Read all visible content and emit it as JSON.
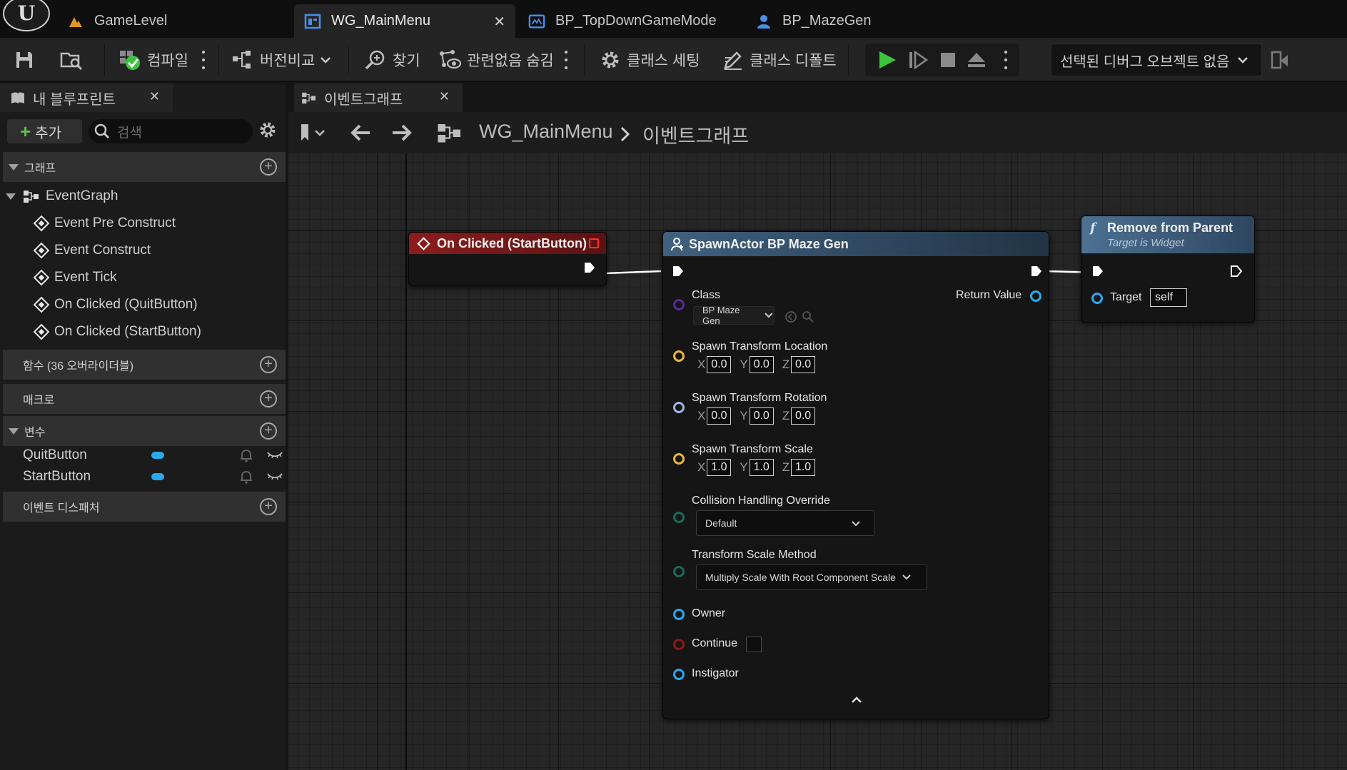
{
  "tabs": [
    {
      "label": "GameLevel",
      "icon": "level-icon"
    },
    {
      "label": "WG_MainMenu",
      "icon": "widget-blueprint-icon",
      "active": true
    },
    {
      "label": "BP_TopDownGameMode",
      "icon": "blueprint-icon"
    },
    {
      "label": "BP_MazeGen",
      "icon": "actor-icon"
    }
  ],
  "toolbar": {
    "compile": "컴파일",
    "diff": "버전비교",
    "find": "찾기",
    "hide_unrelated": "관련없음 숨김",
    "class_settings": "클래스 세팅",
    "class_defaults": "클래스 디폴트",
    "debug_object": "선택된 디버그 오브젝트 없음"
  },
  "my_blueprint": {
    "tab_label": "내 블루프린트",
    "add_label": "추가",
    "search_placeholder": "검색",
    "sections": {
      "graphs": "그래프",
      "functions": "함수 (36 오버라이더블)",
      "macros": "매크로",
      "variables": "변수",
      "dispatchers": "이벤트 디스패처"
    },
    "event_graph": "EventGraph",
    "events": [
      "Event Pre Construct",
      "Event Construct",
      "Event Tick",
      "On Clicked (QuitButton)",
      "On Clicked (StartButton)"
    ],
    "variables": [
      "QuitButton",
      "StartButton"
    ]
  },
  "graph": {
    "tab_label": "이벤트그래프",
    "breadcrumb_root": "WG_MainMenu",
    "breadcrumb_leaf": "이벤트그래프"
  },
  "nodes": {
    "on_clicked": {
      "title": "On Clicked (StartButton)"
    },
    "spawn": {
      "title": "SpawnActor BP Maze Gen",
      "class_label": "Class",
      "class_value": "BP Maze Gen",
      "return_value": "Return Value",
      "location_label": "Spawn Transform Location",
      "location": {
        "x": "0.0",
        "y": "0.0",
        "z": "0.0"
      },
      "rotation_label": "Spawn Transform Rotation",
      "rotation": {
        "x": "0.0",
        "y": "0.0",
        "z": "0.0"
      },
      "scale_label": "Spawn Transform Scale",
      "scale": {
        "x": "1.0",
        "y": "1.0",
        "z": "1.0"
      },
      "collision_label": "Collision Handling Override",
      "collision_value": "Default",
      "scale_method_label": "Transform Scale Method",
      "scale_method_value": "Multiply Scale With Root Component Scale",
      "owner": "Owner",
      "continue": "Continue",
      "instigator": "Instigator"
    },
    "remove": {
      "title": "Remove from Parent",
      "subtitle": "Target is Widget",
      "target_label": "Target",
      "target_value": "self"
    }
  },
  "colors": {
    "event_header": "#7a1a1a",
    "function_header": "#3d5b7a",
    "play_green": "#3cc43c",
    "variable_pill": "#2aa8f0"
  }
}
